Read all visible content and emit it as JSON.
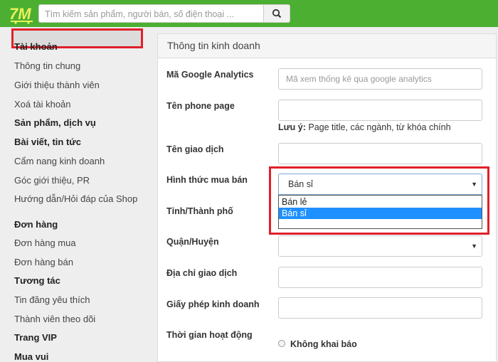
{
  "header": {
    "logo_text": "7M",
    "search_placeholder": "Tìm kiếm sản phẩm, người bán, số điện thoại ..."
  },
  "sidebar": {
    "account_heading": "Tài khoản",
    "account_items": [
      "Thông tin chung",
      "Giới thiệu thành viên",
      "Xoá tài khoản"
    ],
    "products_heading": "Sản phẩm, dịch vụ",
    "posts_heading": "Bài viết, tin tức",
    "posts_items": [
      "Cẩm nang kinh doanh",
      "Góc giới thiệu, PR",
      "Hướng dẫn/Hỏi đáp của Shop"
    ],
    "orders_heading": "Đơn hàng",
    "orders_items": [
      "Đơn hàng mua",
      "Đơn hàng bán"
    ],
    "interaction_heading": "Tương tác",
    "interaction_items": [
      "Tin đăng yêu thích",
      "Thành viên theo dõi"
    ],
    "vip_heading": "Trang VIP",
    "fun_heading": "Mua vui"
  },
  "panel": {
    "title": "Thông tin kinh doanh",
    "fields": {
      "analytics_label": "Mã Google Analytics",
      "analytics_placeholder": "Mã xem thống kê qua google analytics",
      "phone_page_label": "Tên phone page",
      "phone_page_note_bold": "Lưu ý:",
      "phone_page_note": " Page title, các ngành, từ khóa chính",
      "trade_name_label": "Tên giao dịch",
      "trade_type_label": "Hình thức mua bán",
      "trade_type_value": "Bán sỉ",
      "trade_type_options": [
        "Bán lẻ",
        "Bán sỉ"
      ],
      "city_label": "Tỉnh/Thành phố",
      "district_label": "Quận/Huyện",
      "address_label": "Địa chỉ giao dịch",
      "license_label": "Giấy phép kinh doanh",
      "hours_label": "Thời gian hoạt động",
      "hours_option": "Không khai báo"
    }
  },
  "colors": {
    "header_green": "#4caf32",
    "highlight_red": "#e0202a",
    "option_selected_blue": "#1e90ff"
  }
}
